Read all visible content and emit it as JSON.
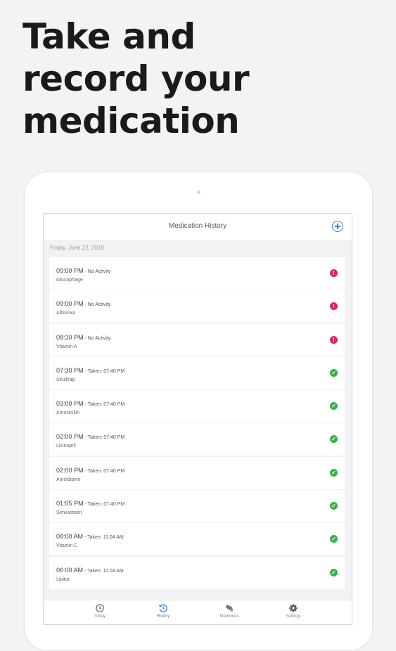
{
  "headline": {
    "lines": [
      "Take and",
      "record your",
      "medication"
    ]
  },
  "navbar": {
    "title": "Medication History",
    "add_icon": "plus-circle-icon"
  },
  "date_header": "Friday, June 22, 2018",
  "entries": [
    {
      "time": "09:00 PM",
      "status": " - No Activity",
      "name": "Glucophage",
      "state": "missed"
    },
    {
      "time": "09:00 PM",
      "status": " - No Activity",
      "name": "Albinoxa",
      "state": "missed"
    },
    {
      "time": "08:30 PM",
      "status": " - No Activity",
      "name": "Vitamin A",
      "state": "missed"
    },
    {
      "time": "07:30 PM",
      "status": " - Taken: 07:40 PM",
      "name": "Skullcap",
      "state": "taken"
    },
    {
      "time": "03:00 PM",
      "status": " - Taken: 07:40 PM",
      "name": "Amoxicillin",
      "state": "taken"
    },
    {
      "time": "02:00 PM",
      "status": " - Taken: 07:40 PM",
      "name": "Lisinopril",
      "state": "taken"
    },
    {
      "time": "02:00 PM",
      "status": " - Taken: 07:40 PM",
      "name": "Amoldipine",
      "state": "taken"
    },
    {
      "time": "01:05 PM",
      "status": " - Taken: 07:40 PM",
      "name": "Simvastatin",
      "state": "taken"
    },
    {
      "time": "08:00 AM",
      "status": " - Taken: 11:04 AM",
      "name": "Vitamin C",
      "state": "taken"
    },
    {
      "time": "06:00 AM",
      "status": " - Taken: 11:04 AM",
      "name": "Lipitor",
      "state": "taken"
    }
  ],
  "status_icons": {
    "missed": "exclamation-circle-icon",
    "taken": "check-circle-icon"
  },
  "tabs": [
    {
      "label": "Today",
      "icon": "clock-icon",
      "active": false
    },
    {
      "label": "History",
      "icon": "history-icon",
      "active": true
    },
    {
      "label": "Medicines",
      "icon": "pill-icon",
      "active": false
    },
    {
      "label": "Settings",
      "icon": "gear-icon",
      "active": false
    }
  ],
  "colors": {
    "accent": "#3a84c9",
    "missed": "#e0245e",
    "taken": "#34b24a"
  }
}
